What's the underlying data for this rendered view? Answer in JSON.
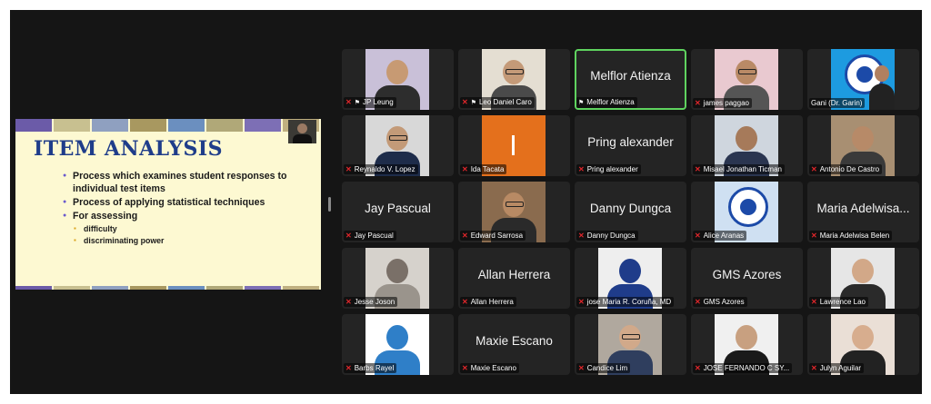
{
  "slide": {
    "title": "ITEM ANALYSIS",
    "bullets": [
      {
        "text": "Process which examines student responses to individual test items",
        "level": 1
      },
      {
        "text": "Process of applying statistical techniques",
        "level": 1
      },
      {
        "text": "For assessing",
        "level": 1
      },
      {
        "text": "difficulty",
        "level": 2
      },
      {
        "text": "discriminating power",
        "level": 2
      }
    ],
    "stripe_colors": [
      "#6b5ba8",
      "#c8c090",
      "#8fa0c0",
      "#a89860",
      "#6b8fbf",
      "#b0a878",
      "#7d6fb5",
      "#c0b080"
    ]
  },
  "participants": [
    {
      "name": "JP Leung",
      "muted": true,
      "pinned": true,
      "video": true,
      "bg": "#c9c0d8",
      "skin": "#c79a73",
      "shirt": "#2d2d2d",
      "glasses": false
    },
    {
      "name": "Leo Daniel Caro",
      "muted": true,
      "pinned": true,
      "video": true,
      "bg": "#e4ded2",
      "skin": "#c49a78",
      "shirt": "#4a4a4a",
      "glasses": true
    },
    {
      "name": "Melflor Atienza",
      "muted": false,
      "pinned": true,
      "video": false,
      "active": true,
      "display": "Melflor Atienza"
    },
    {
      "name": "james paggao",
      "muted": true,
      "pinned": false,
      "video": true,
      "bg": "#e9c9d0",
      "skin": "#b98a66",
      "shirt": "#555",
      "glasses": true
    },
    {
      "name": "Gani (Dr. Garin)",
      "muted": false,
      "pinned": false,
      "video": true,
      "logo": true,
      "bg": "#1d9be0",
      "skin": "#b08060",
      "shirt": "#222"
    },
    {
      "name": "Reynaldo V. Lopez",
      "muted": true,
      "pinned": false,
      "video": true,
      "bg": "#d8d8d8",
      "skin": "#c39a78",
      "shirt": "#1e2c4a",
      "glasses": true
    },
    {
      "name": "Ida Tacata",
      "muted": true,
      "pinned": false,
      "video": true,
      "solid": "#e4701c"
    },
    {
      "name": "Pring alexander",
      "muted": true,
      "pinned": false,
      "video": false,
      "display": "Pring alexander"
    },
    {
      "name": "Misael Jonathan Ticman",
      "muted": true,
      "pinned": false,
      "video": true,
      "bg": "#cfd6de",
      "skin": "#a67a5a",
      "shirt": "#2a3550",
      "glasses": false
    },
    {
      "name": "Antonio De Castro",
      "muted": true,
      "pinned": false,
      "video": true,
      "bg": "#a88f72",
      "skin": "#b78a68",
      "shirt": "#3a3a3a",
      "glasses": false
    },
    {
      "name": "Jay Pascual",
      "muted": true,
      "pinned": false,
      "video": false,
      "display": "Jay Pascual"
    },
    {
      "name": "Edward Sarrosa",
      "muted": true,
      "pinned": false,
      "video": true,
      "bg": "#8a6b4e",
      "skin": "#b88a64",
      "shirt": "#2a2a2a",
      "glasses": true
    },
    {
      "name": "Danny Dungca",
      "muted": true,
      "pinned": false,
      "video": false,
      "display": "Danny Dungca"
    },
    {
      "name": "Alice Aranas",
      "muted": true,
      "pinned": false,
      "video": true,
      "logo": true,
      "bg": "#cfe0f2"
    },
    {
      "name": "Maria Adelwisa Belen",
      "muted": true,
      "pinned": false,
      "video": false,
      "display": "Maria Adelwisa..."
    },
    {
      "name": "Jesse Joson",
      "muted": true,
      "pinned": false,
      "video": true,
      "bg": "#d6d2cc",
      "skin": "#7a7068",
      "shirt": "#9a948c",
      "glasses": false
    },
    {
      "name": "Allan Herrera",
      "muted": true,
      "pinned": false,
      "video": false,
      "display": "Allan Herrera"
    },
    {
      "name": "jose Maria R. Coruña, MD",
      "muted": true,
      "pinned": false,
      "video": true,
      "bg": "#eeeeee",
      "skin": "#1f3c8a",
      "shirt": "#1f3c8a",
      "glasses": false
    },
    {
      "name": "GMS Azores",
      "muted": true,
      "pinned": false,
      "video": false,
      "display": "GMS Azores"
    },
    {
      "name": "Lawrence Lao",
      "muted": true,
      "pinned": false,
      "video": true,
      "bg": "#e6e6e6",
      "skin": "#d2a888",
      "shirt": "#2a2a2a",
      "glasses": false
    },
    {
      "name": "Barbs Rayel",
      "muted": true,
      "pinned": false,
      "video": true,
      "bg": "#ffffff",
      "skin": "#2f7fc8",
      "shirt": "#2f7fc8",
      "glasses": false
    },
    {
      "name": "Maxie Escano",
      "muted": true,
      "pinned": false,
      "video": false,
      "display": "Maxie Escano"
    },
    {
      "name": "Candice Lim",
      "muted": true,
      "pinned": false,
      "video": true,
      "bg": "#b0a89e",
      "skin": "#d1a98a",
      "shirt": "#2f3e5e",
      "glasses": true
    },
    {
      "name": "JOSE FERNANDO C SY...",
      "muted": true,
      "pinned": false,
      "video": true,
      "bg": "#f0f0f0",
      "skin": "#c8a080",
      "shirt": "#1a1a1a",
      "glasses": false
    },
    {
      "name": "Julyn Aguilar",
      "muted": true,
      "pinned": false,
      "video": true,
      "bg": "#eadfd6",
      "skin": "#d7ad8e",
      "shirt": "#222",
      "glasses": false
    }
  ]
}
